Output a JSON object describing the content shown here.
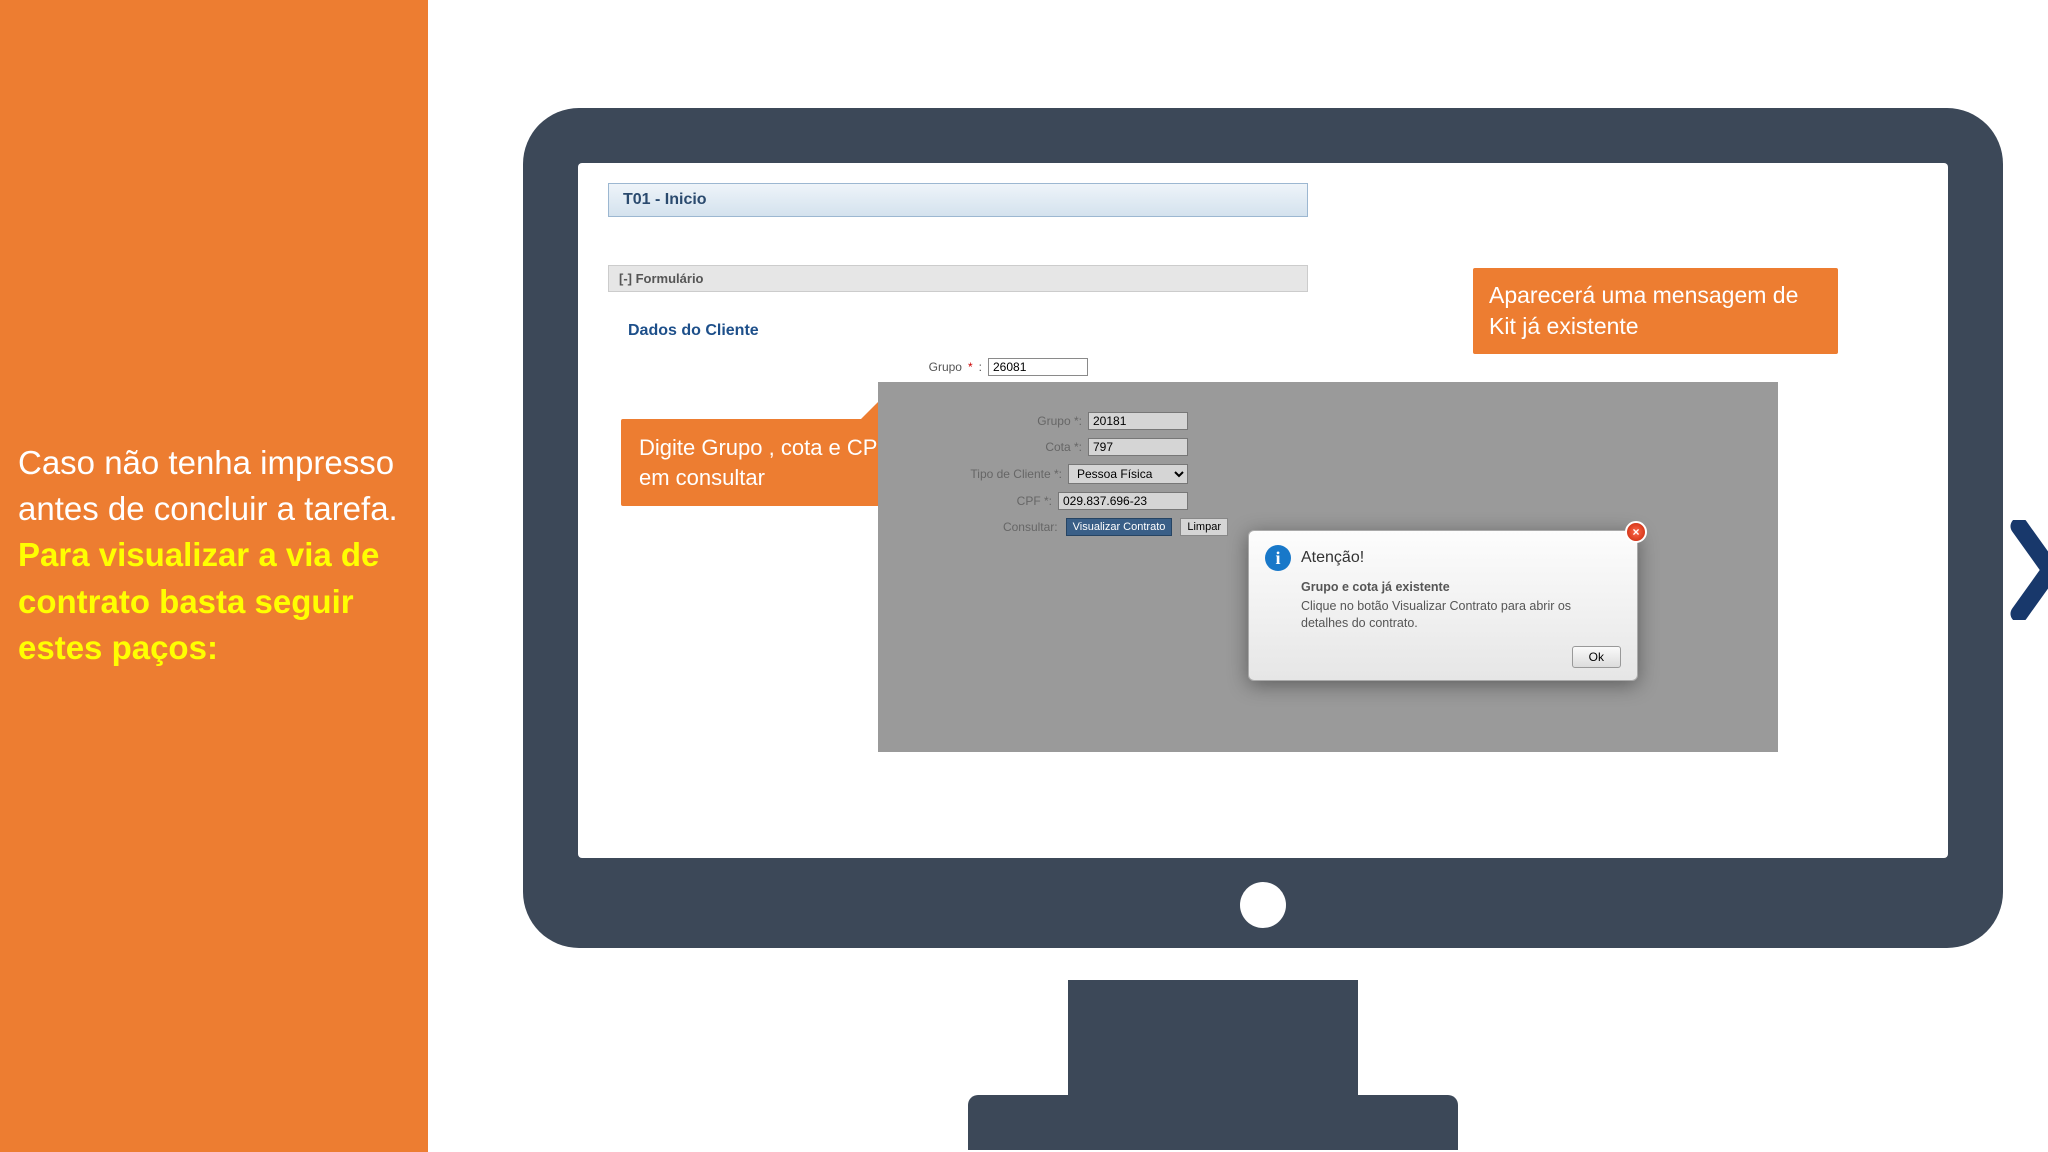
{
  "sidebar": {
    "text_white": "Caso não tenha impresso antes de concluir a tarefa. ",
    "text_yellow": "Para visualizar a via de contrato basta seguir estes paços:"
  },
  "form": {
    "header": "T01 - Inicio",
    "section_toggle": "[-] Formulário",
    "section_title": "Dados do Cliente",
    "labels": {
      "grupo": "Grupo",
      "cota": "Cota",
      "tipo_cliente": "Tipo de Cliente",
      "cpf": "CPF"
    },
    "required_mark": "*",
    "values": {
      "grupo": "26081",
      "cota": "797",
      "tipo_cliente": "Pessoa Física",
      "cpf": "029.837.696-23"
    },
    "buttons": {
      "consultar": "Consultar",
      "limpar": "Limpar"
    }
  },
  "callout1": "Digite Grupo , cota e CPF e clique em consultar",
  "callout2": "Aparecerá uma mensagem de Kit já existente",
  "overlay": {
    "labels": {
      "grupo": "Grupo *:",
      "cota": "Cota *:",
      "tipo_cliente": "Tipo de Cliente *:",
      "cpf": "CPF *:",
      "consultar_label": "Consultar:"
    },
    "values": {
      "grupo": "20181",
      "cota": "797",
      "tipo_cliente": "Pessoa Física",
      "cpf": "029.837.696-23"
    },
    "buttons": {
      "visualizar": "Visualizar Contrato",
      "limpar": "Limpar"
    }
  },
  "dialog": {
    "title": "Atenção!",
    "line1": "Grupo e cota já existente",
    "line2": "Clique no botão Visualizar Contrato para abrir os detalhes do contrato.",
    "ok": "Ok",
    "close": "×",
    "icon": "i"
  }
}
